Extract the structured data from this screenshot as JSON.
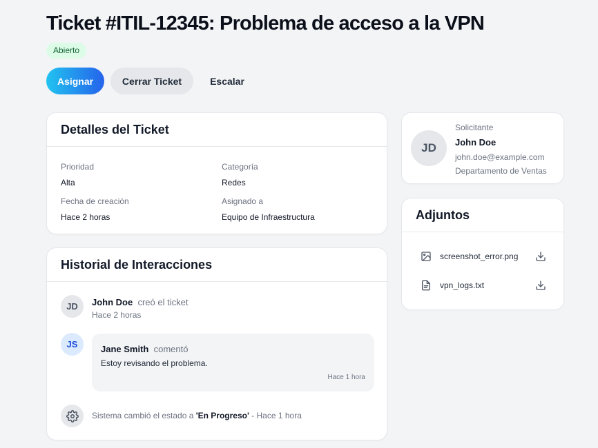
{
  "ticket": {
    "title": "Ticket #ITIL-12345: Problema de acceso a la VPN",
    "status": "Abierto"
  },
  "actions": {
    "assign": "Asignar",
    "close": "Cerrar Ticket",
    "escalate": "Escalar"
  },
  "details": {
    "heading": "Detalles del Ticket",
    "priority_label": "Prioridad",
    "priority_value": "Alta",
    "category_label": "Categoría",
    "category_value": "Redes",
    "created_label": "Fecha de creación",
    "created_value": "Hace 2 horas",
    "assigned_label": "Asignado a",
    "assigned_value": "Equipo de Infraestructura"
  },
  "history": {
    "heading": "Historial de Interacciones",
    "events": [
      {
        "initials": "JD",
        "name": "John Doe",
        "action": "creó el ticket",
        "time": "Hace 2 horas"
      },
      {
        "initials": "JS",
        "name": "Jane Smith",
        "action": "comentó",
        "text": "Estoy revisando el problema.",
        "time": "Hace 1 hora"
      },
      {
        "icon": "gear-icon",
        "prefix": "Sistema cambió el estado a",
        "status": "'En Progreso'",
        "suffix": "- Hace 1 hora"
      }
    ]
  },
  "requester": {
    "initials": "JD",
    "label": "Solicitante",
    "name": "John Doe",
    "email": "john.doe@example.com",
    "department": "Departamento de Ventas"
  },
  "attachments": {
    "heading": "Adjuntos",
    "files": [
      {
        "name": "screenshot_error.png",
        "icon": "image-icon"
      },
      {
        "name": "vpn_logs.txt",
        "icon": "document-icon"
      }
    ]
  },
  "colors": {
    "accent_start": "#22c3f0",
    "accent_end": "#2563eb",
    "status_bg": "#dcfce7",
    "status_text": "#166534"
  }
}
